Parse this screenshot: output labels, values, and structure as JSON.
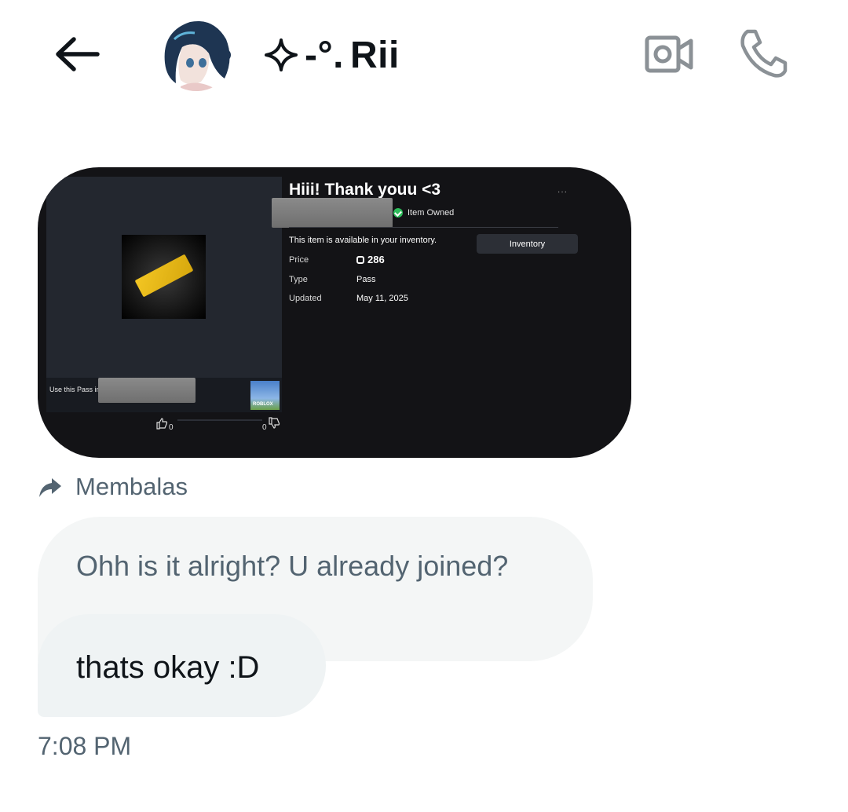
{
  "header": {
    "back_icon": "arrow-left-icon",
    "contact_prefix": "-°.",
    "contact_name": "Rii",
    "sparkle_icon": "sparkle-icon",
    "video_icon": "video-call-icon",
    "phone_icon": "phone-icon"
  },
  "attachment": {
    "title": "Hiii! Thank youu <3",
    "owned_label": "Item Owned",
    "availability_text": "This item is available in your inventory.",
    "inventory_button": "Inventory",
    "details": [
      {
        "label": "Price",
        "value": "286"
      },
      {
        "label": "Type",
        "value": "Pass"
      },
      {
        "label": "Updated",
        "value": "May 11, 2025"
      }
    ],
    "use_pass_label": "Use this Pass in:",
    "game_badge": "ROBLOX",
    "likes": "0",
    "dislikes": "0",
    "more_label": "···"
  },
  "reply": {
    "label": "Membalas",
    "quoted_text": "Ohh is it alright? U already joined?"
  },
  "message": {
    "text": "thats okay :D",
    "time": "7:08 PM"
  },
  "colors": {
    "accent_text": "#0f1419",
    "secondary_text": "#536471",
    "bubble_bg": "#eff3f4",
    "quoted_bg": "#f4f6f6"
  }
}
